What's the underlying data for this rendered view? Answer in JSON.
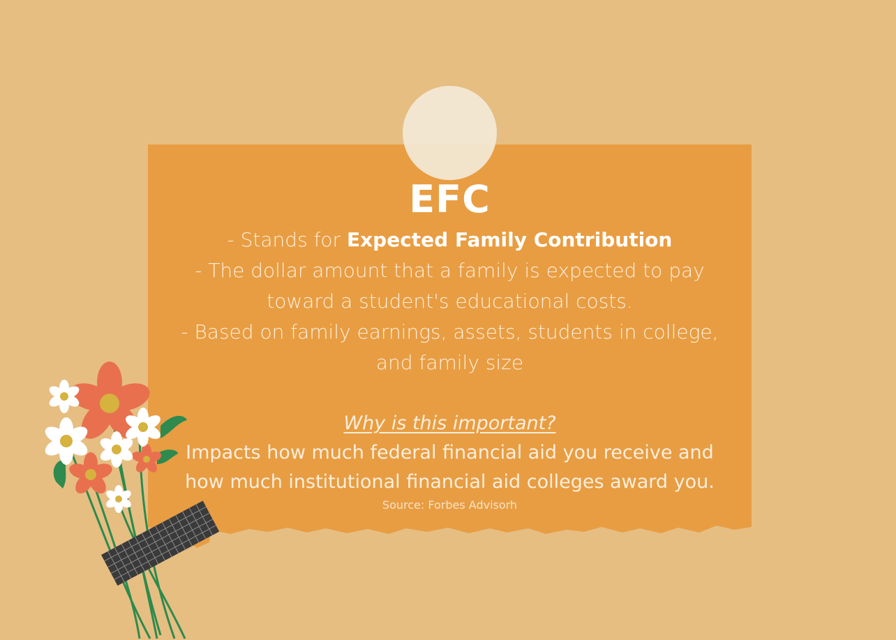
{
  "card": {
    "title": "EFC",
    "line1_prefix": "- Stands for ",
    "line1_bold": "Expected Family Contribution",
    "line2": "- The dollar amount that a family is expected to pay",
    "line3": "toward a student's educational costs.",
    "line4": "- Based on family earnings, assets, students in college,",
    "line5": "and family size",
    "why_heading": "Why is this important?",
    "impact_line1": "Impacts how much federal financial aid you receive and",
    "impact_line2": "how much institutional financial aid colleges award you.",
    "source": "Source: Forbes Advisorh"
  },
  "colors": {
    "background": "#E6BE82",
    "card": "#E89D42",
    "pin": "#F2E8D6",
    "flower_coral": "#E8704F",
    "flower_white": "#FFFFFF",
    "flower_center": "#D6B23E",
    "leaf": "#2E8A4E",
    "tape": "#3A3A3A"
  },
  "decorations": {
    "pin": "pin-circle-icon",
    "bouquet": "flower-bouquet-icon",
    "tape": "tape-strip-icon"
  }
}
